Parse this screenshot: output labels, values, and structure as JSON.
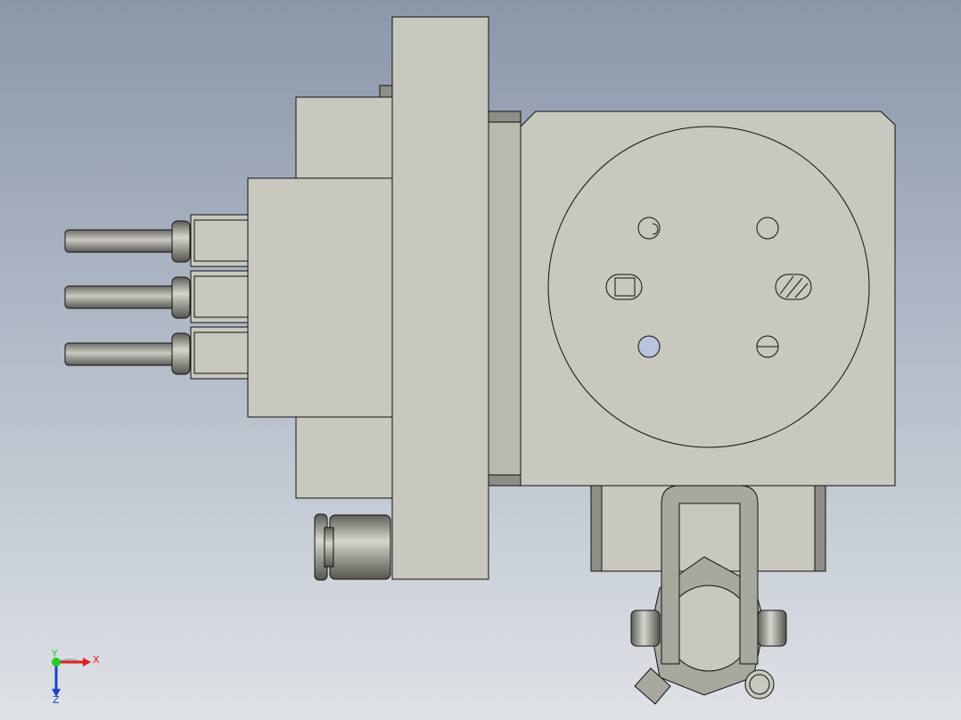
{
  "triad": {
    "x_label": "X",
    "y_label": "Y",
    "z_label": "Z",
    "x_color": "#e02020",
    "y_color": "#22cc22",
    "z_color": "#2040d0"
  },
  "colors": {
    "background_top": "#8a97aa",
    "background_bottom": "#dfe2e6",
    "body": "#c8c8bf",
    "body_dark": "#a8a89e",
    "edge": "#111111",
    "metal": "#8e8e86"
  }
}
